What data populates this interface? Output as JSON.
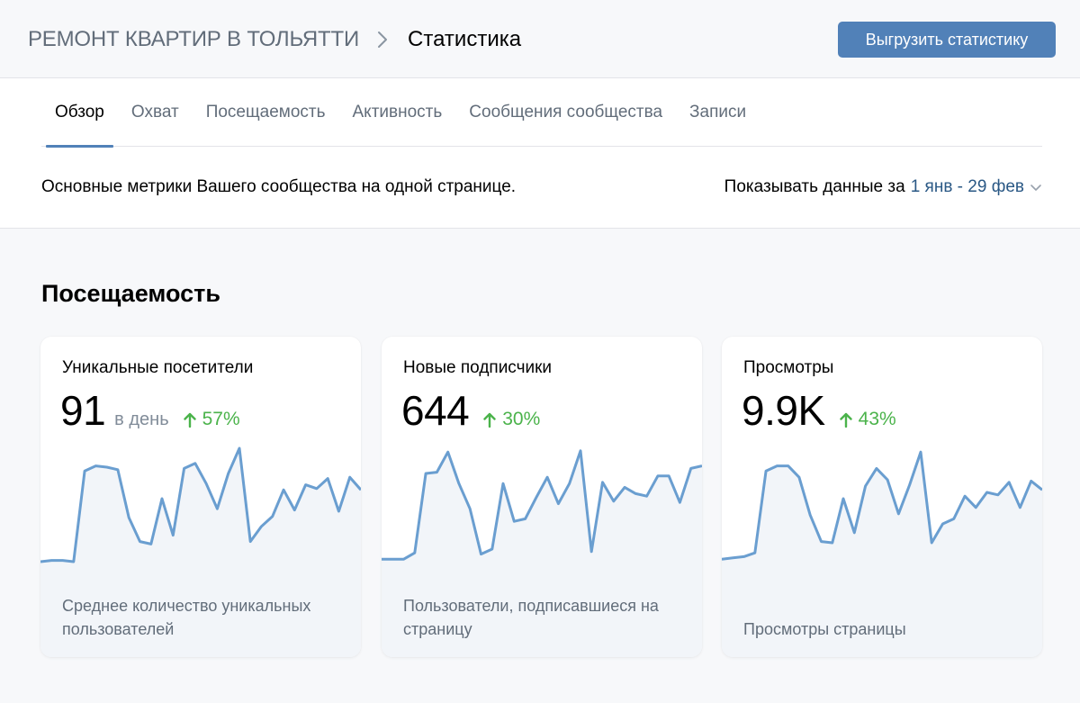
{
  "header": {
    "group_name": "РЕМОНТ КВАРТИР В ТОЛЬЯТТИ",
    "page_title": "Статистика",
    "export_button": "Выгрузить статистику"
  },
  "tabs": [
    {
      "label": "Обзор",
      "active": true
    },
    {
      "label": "Охват",
      "active": false
    },
    {
      "label": "Посещаемость",
      "active": false
    },
    {
      "label": "Активность",
      "active": false
    },
    {
      "label": "Сообщения сообщества",
      "active": false
    },
    {
      "label": "Записи",
      "active": false
    }
  ],
  "overview": {
    "description": "Основные метрики Вашего сообщества на одной странице.",
    "period_label": "Показывать данные за",
    "period_value": "1 янв - 29 фев"
  },
  "section": {
    "title": "Посещаемость"
  },
  "colors": {
    "accent": "#5181b8",
    "link": "#2a5885",
    "positive": "#4bb34b",
    "sparkline": "#6a9ed0",
    "sparkline_fill": "#f2f5f9"
  },
  "icons": {
    "breadcrumb": "chevron-right-icon",
    "period": "chevron-down-icon",
    "delta": "arrow-up-icon"
  },
  "cards": [
    {
      "title": "Уникальные посетители",
      "value": "91",
      "unit": "в день",
      "delta": "57%",
      "footer": "Среднее количество уникальных пользователей",
      "chart_data": {
        "type": "area",
        "values": [
          10,
          11,
          11,
          10,
          82,
          86,
          85,
          83,
          45,
          26,
          24,
          60,
          31,
          84,
          88,
          72,
          52,
          80,
          100,
          26,
          38,
          46,
          67,
          51,
          71,
          68,
          76,
          50,
          77,
          67
        ]
      }
    },
    {
      "title": "Новые подписчики",
      "value": "644",
      "unit": "",
      "delta": "30%",
      "footer": "Пользователи, подписавшиеся на страницу",
      "chart_data": {
        "type": "area",
        "values": [
          12,
          12,
          12,
          17,
          80,
          81,
          97,
          72,
          52,
          16,
          20,
          72,
          42,
          44,
          61,
          77,
          56,
          72,
          98,
          18,
          73,
          58,
          69,
          64,
          62,
          78,
          78,
          57,
          84,
          86
        ]
      }
    },
    {
      "title": "Просмотры",
      "value": "9.9K",
      "unit": "",
      "delta": "43%",
      "footer": "Просмотры страницы",
      "chart_data": {
        "type": "area",
        "values": [
          12,
          13,
          14,
          17,
          82,
          86,
          86,
          77,
          47,
          26,
          25,
          60,
          33,
          70,
          84,
          75,
          48,
          71,
          97,
          25,
          40,
          44,
          62,
          53,
          65,
          63,
          73,
          53,
          74,
          67
        ]
      }
    }
  ]
}
